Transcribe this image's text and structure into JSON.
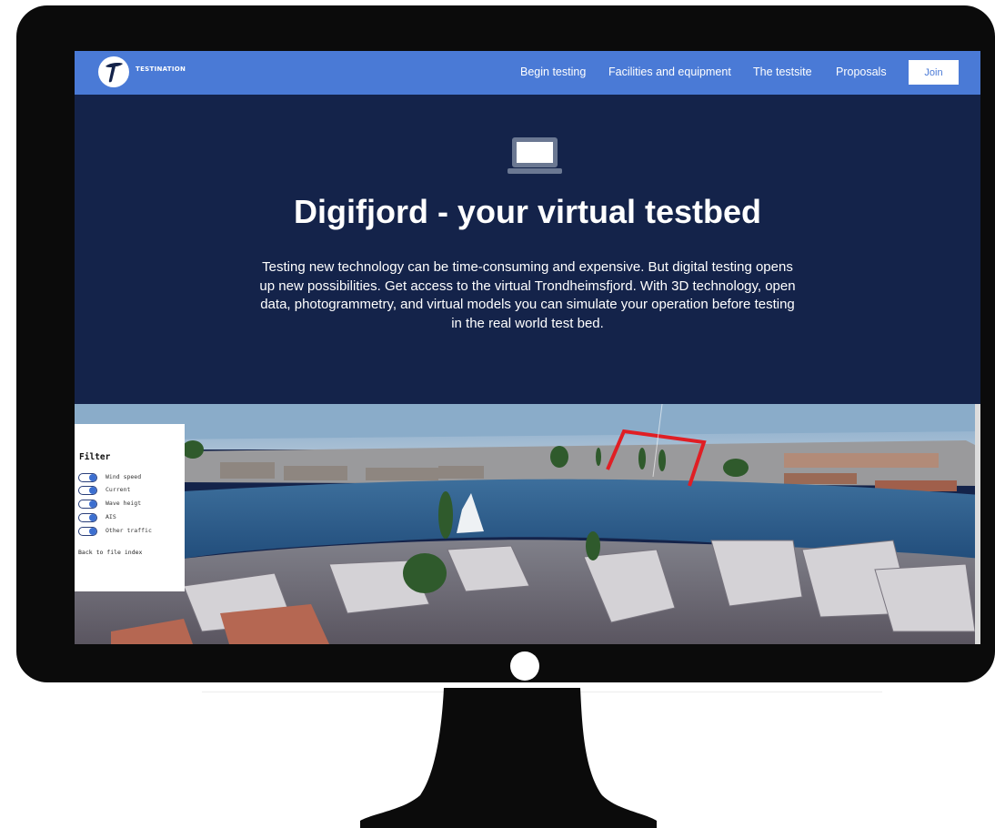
{
  "navbar": {
    "brand": "TESTINATION",
    "links": [
      {
        "label": "Begin testing"
      },
      {
        "label": "Facilities and equipment"
      },
      {
        "label": "The testsite"
      },
      {
        "label": "Proposals"
      }
    ],
    "join_label": "Join"
  },
  "hero": {
    "icon": "laptop-icon",
    "title": "Digifjord - your virtual testbed",
    "text": "Testing new technology can be time-consuming and expensive. But digital testing opens up new possibilities. Get access to the virtual Trondheimsfjord. With 3D technology, open data, photogrammetry, and virtual models you can simulate your operation before testing in the real world test bed."
  },
  "filter": {
    "title": "Filter",
    "items": [
      {
        "label": "Wind speed"
      },
      {
        "label": "Current"
      },
      {
        "label": "Wave heigt"
      },
      {
        "label": "AIS"
      },
      {
        "label": "Other traffic"
      }
    ],
    "back_link": "Back to file index"
  },
  "colors": {
    "navbar": "#4a7ad6",
    "hero_bg": "#14234a",
    "monitor": "#0b0b0b",
    "water": "#2e5e8c",
    "marker": "#e01e24"
  }
}
